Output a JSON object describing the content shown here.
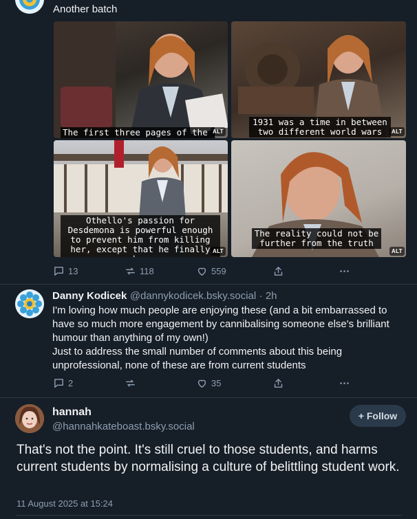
{
  "post1": {
    "text": "Another batch",
    "images": [
      {
        "caption": "The first three pages of the novel exte",
        "alt_badge": "ALT"
      },
      {
        "caption": "1931 was a time in between two different world wars",
        "alt_badge": "ALT"
      },
      {
        "caption": "Othello's passion for Desdemona is powerful enough to prevent him from killing her, except that he finally does",
        "alt_badge": "ALT"
      },
      {
        "caption": "The reality could not be further from the truth",
        "alt_badge": "ALT"
      }
    ],
    "replies": "13",
    "reposts": "118",
    "likes": "559"
  },
  "post2": {
    "author": "Danny Kodicek",
    "handle": "@dannykodicek.bsky.social",
    "time": "· 2h",
    "text": "I'm loving how much people are enjoying these (and a bit embarrassed to have so much more engagement by cannibalising someone else's brilliant humour than anything of my own!)\nJust to address the small number of comments about this being unprofessional, none of these are from current students",
    "replies": "2",
    "reposts": "",
    "likes": "35"
  },
  "post3": {
    "author": "hannah",
    "handle": "@hannahkateboast.bsky.social",
    "follow_label": "+ Follow",
    "text": "That's not the point. It's still cruel to those students, and harms current students by normalising a culture of belittling student work.",
    "timestamp": "11 August 2025 at 15:24"
  },
  "icons": {
    "reply": "reply-icon",
    "repost": "repost-icon",
    "like": "heart-icon",
    "share": "share-icon",
    "more": "more-icon"
  },
  "colors": {
    "background": "#161e27",
    "muted": "#8d9fb2",
    "text": "#f1f3f5"
  }
}
